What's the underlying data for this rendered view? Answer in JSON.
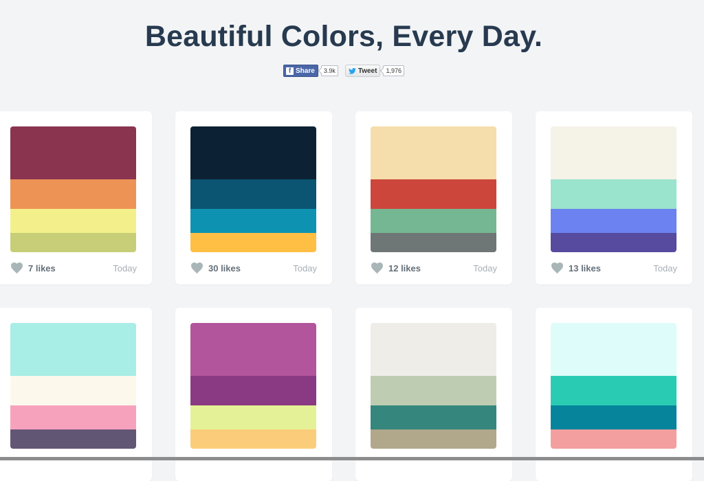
{
  "header": {
    "title": "Beautiful Colors, Every Day."
  },
  "social": {
    "facebook": {
      "icon": "facebook-f-icon",
      "label": "Share",
      "count": "3.9k"
    },
    "twitter": {
      "icon": "twitter-bird-icon",
      "label": "Tweet",
      "count": "1,976"
    }
  },
  "colors": {
    "heart": "#a9b6b8",
    "title": "#273a4f",
    "background": "#f3f4f6"
  },
  "palettes": [
    {
      "likes": "7 likes",
      "date": "Today",
      "colors": [
        "#8a3450",
        "#ee9356",
        "#f3f08c",
        "#c7ce77"
      ]
    },
    {
      "likes": "30 likes",
      "date": "Today",
      "colors": [
        "#0c2133",
        "#0b5472",
        "#0d93b1",
        "#ffbf45"
      ]
    },
    {
      "likes": "12 likes",
      "date": "Today",
      "colors": [
        "#f5deab",
        "#cc463c",
        "#74b792",
        "#6f7676"
      ]
    },
    {
      "likes": "13 likes",
      "date": "Today",
      "colors": [
        "#f5f2e8",
        "#9ae3cd",
        "#6b82f0",
        "#564b9e"
      ]
    },
    {
      "likes": "",
      "date": "",
      "colors": [
        "#a8ede6",
        "#fcf9ec",
        "#f7a2bd",
        "#625675"
      ]
    },
    {
      "likes": "",
      "date": "",
      "colors": [
        "#b2559c",
        "#8a3a83",
        "#e5f196",
        "#fbcd7a"
      ]
    },
    {
      "likes": "",
      "date": "",
      "colors": [
        "#efede8",
        "#becdb2",
        "#35867d",
        "#b1a78b"
      ]
    },
    {
      "likes": "",
      "date": "",
      "colors": [
        "#defdfa",
        "#29ccb3",
        "#05849c",
        "#f39f9f"
      ]
    }
  ]
}
